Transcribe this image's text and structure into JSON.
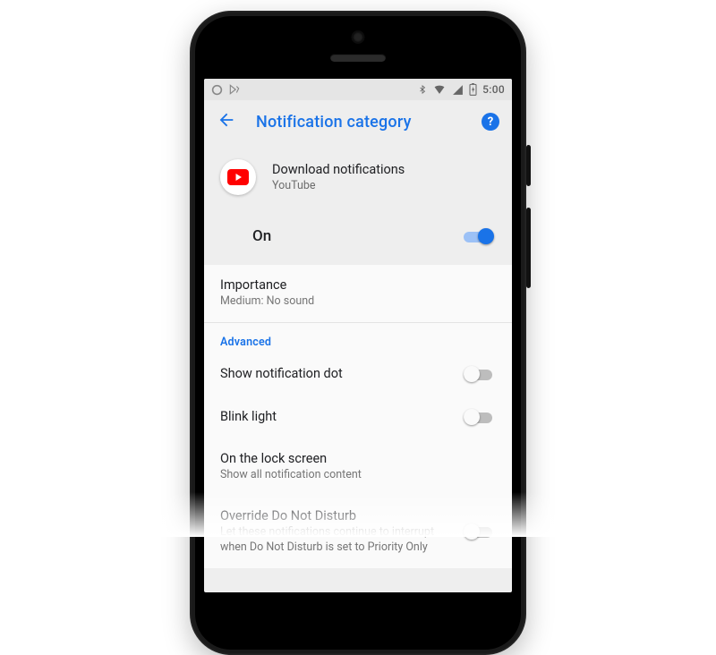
{
  "status": {
    "time": "5:00"
  },
  "appbar": {
    "title": "Notification category"
  },
  "app": {
    "channel": "Download notifications",
    "name": "YouTube"
  },
  "master": {
    "label": "On",
    "on": true
  },
  "importance": {
    "title": "Importance",
    "value": "Medium: No sound"
  },
  "advanced": {
    "label": "Advanced",
    "dot": {
      "title": "Show notification dot",
      "on": false
    },
    "blink": {
      "title": "Blink light",
      "on": false
    },
    "lock": {
      "title": "On the lock screen",
      "value": "Show all notification content"
    },
    "dnd": {
      "title": "Override Do Not Disturb",
      "value": "Let these notifications continue to interrupt when Do Not Disturb is set to Priority Only",
      "on": false
    }
  }
}
